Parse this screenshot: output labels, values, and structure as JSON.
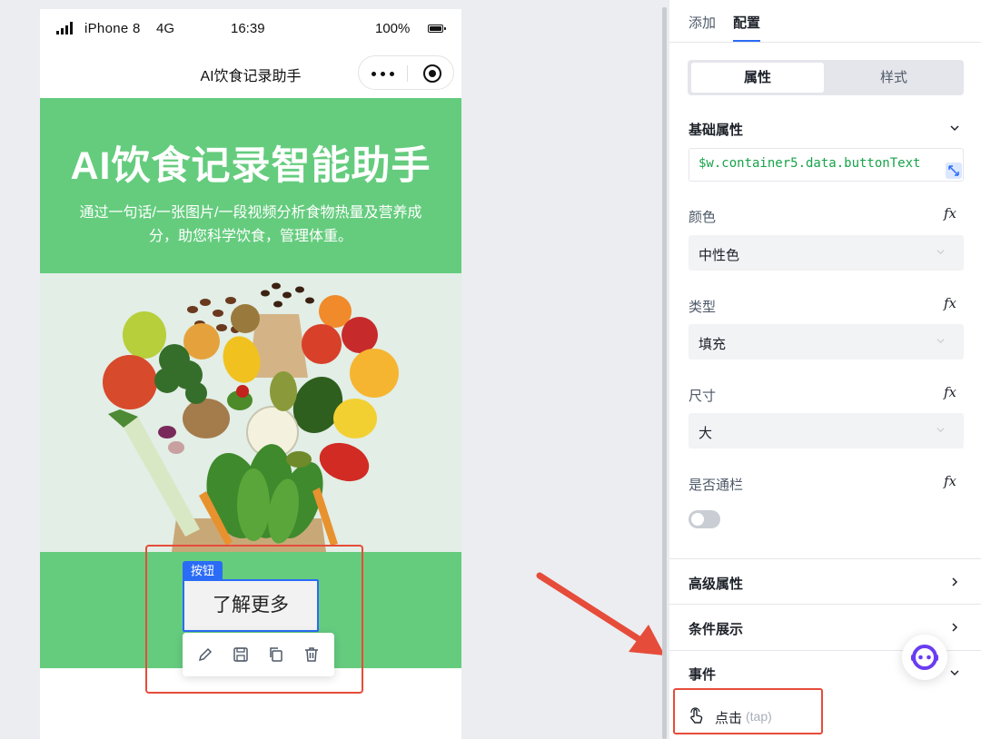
{
  "status_bar": {
    "carrier": "iPhone 8",
    "network": "4G",
    "time": "16:39",
    "battery": "100%"
  },
  "mini_program": {
    "title": "AI饮食记录助手",
    "hero_title": "AI饮食记录智能助手",
    "hero_subtitle": "通过一句话/一张图片/一段视频分析食物热量及营养成分，助您科学饮食，管理体重。",
    "button_tag": "按钮",
    "button_label": "了解更多",
    "toolbar_icons": [
      "edit-icon",
      "save-icon",
      "copy-icon",
      "delete-icon"
    ]
  },
  "panel": {
    "tabs": [
      {
        "label": "添加"
      },
      {
        "label": "配置"
      }
    ],
    "segments": [
      {
        "label": "属性"
      },
      {
        "label": "样式"
      }
    ],
    "basic_section": {
      "title": "基础属性",
      "expression": "$w.container5.data.buttonText",
      "fields": [
        {
          "label": "颜色",
          "value": "中性色"
        },
        {
          "label": "类型",
          "value": "填充"
        },
        {
          "label": "尺寸",
          "value": "大"
        }
      ],
      "fullwidth_label": "是否通栏",
      "fullwidth_on": false,
      "fx_symbol": "fx"
    },
    "advanced_title": "高级属性",
    "condition_title": "条件展示",
    "events_title": "事件",
    "event": {
      "label": "点击",
      "sub": "(tap)"
    }
  },
  "colors": {
    "hero_green": "#65cc7e",
    "selection_blue": "#2b6cf6",
    "annotation_red": "#e64c3a"
  }
}
